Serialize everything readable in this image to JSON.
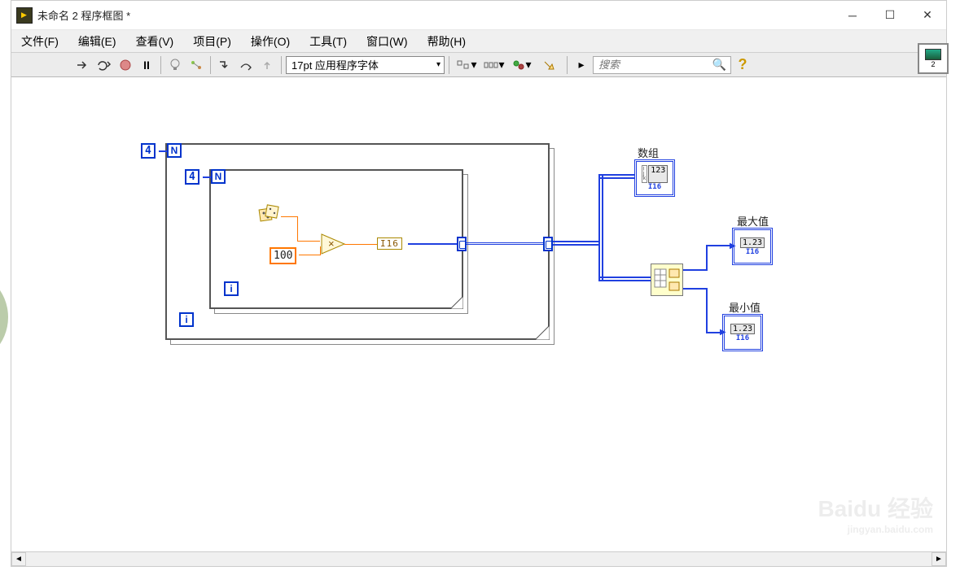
{
  "window": {
    "title": "未命名 2 程序框图 *"
  },
  "menus": {
    "file": "文件(F)",
    "edit": "编辑(E)",
    "view": "查看(V)",
    "project": "项目(P)",
    "operate": "操作(O)",
    "tools": "工具(T)",
    "window": "窗口(W)",
    "help": "帮助(H)"
  },
  "toolbar": {
    "font": "17pt 应用程序字体",
    "search_placeholder": "搜索"
  },
  "diagram": {
    "outer_loop_count": "4",
    "outer_loop_N": "N",
    "outer_loop_i": "i",
    "inner_loop_count": "4",
    "inner_loop_N": "N",
    "inner_loop_i": "i",
    "constant": "100",
    "conversion": "I16",
    "array_label": "数组",
    "max_label": "最大值",
    "min_label": "最小值",
    "indicator_val": "1.23",
    "indicator_arr": "123",
    "indicator_type": "I16"
  },
  "badge": {
    "num": "2"
  },
  "watermark": {
    "brand": "Baidu 经验",
    "url": "jingyan.baidu.com"
  }
}
